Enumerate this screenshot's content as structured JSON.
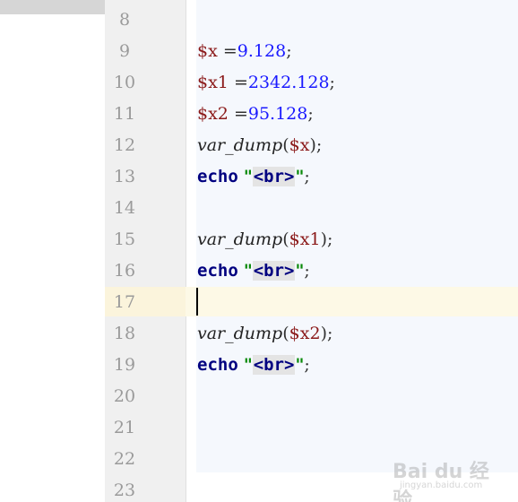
{
  "editor": {
    "line_numbers": [
      "8",
      "9",
      "10",
      "11",
      "12",
      "13",
      "14",
      "15",
      "16",
      "17",
      "18",
      "19",
      "20",
      "21",
      "22",
      "23"
    ],
    "current_line": "17",
    "lines": {
      "l9": {
        "var": "$x",
        "op": " =",
        "num": "9.128",
        "end": ";"
      },
      "l10": {
        "var": "$x1",
        "op": " =",
        "num": "2342.128",
        "end": ";"
      },
      "l11": {
        "var": "$x2",
        "op": " =",
        "num": "95.128",
        "end": ";"
      },
      "l12": {
        "fn": "var_dump",
        "open": "(",
        "var": "$x",
        "close": ")",
        "end": ";"
      },
      "l13": {
        "kw": "echo",
        "q1": "\"",
        "tag": "<br>",
        "q2": "\"",
        "end": ";"
      },
      "l15": {
        "fn": "var_dump",
        "open": "(",
        "var": "$x1",
        "close": ")",
        "end": ";"
      },
      "l16": {
        "kw": "echo",
        "q1": "\"",
        "tag": "<br>",
        "q2": "\"",
        "end": ";"
      },
      "l18": {
        "fn": "var_dump",
        "open": "(",
        "var": "$x2",
        "close": ")",
        "end": ";"
      },
      "l19": {
        "kw": "echo",
        "q1": "\"",
        "tag": "<br>",
        "q2": "\"",
        "end": ";"
      }
    }
  },
  "watermark": {
    "logo": "Bai du 经验",
    "sub": "jingyan.baidu.com"
  }
}
